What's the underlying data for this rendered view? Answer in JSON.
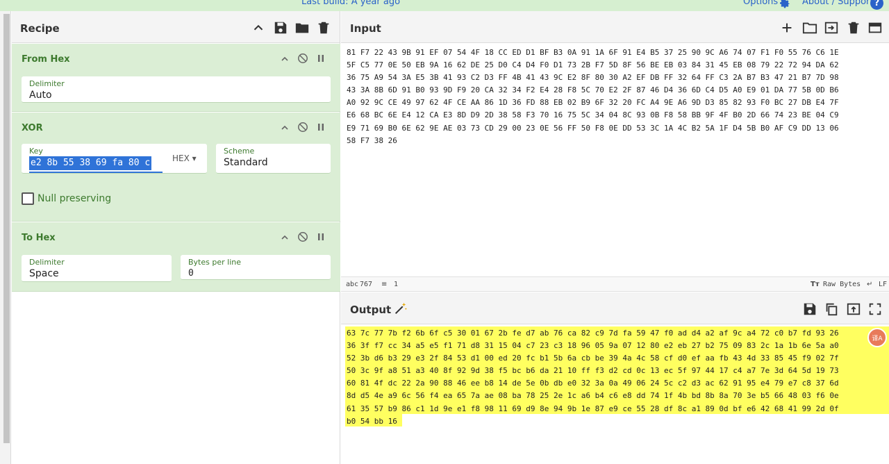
{
  "banner": {
    "last_build": "Last build: A year ago",
    "options": "Options",
    "about": "About / Support",
    "help_glyph": "?"
  },
  "recipe": {
    "title": "Recipe",
    "icons": [
      "chevron-up-icon",
      "save-icon",
      "folder-icon",
      "trash-icon"
    ],
    "operations": [
      {
        "title": "From Hex",
        "fields": [
          {
            "label": "Delimiter",
            "value": "Auto"
          }
        ]
      },
      {
        "title": "XOR",
        "key": {
          "label": "Key",
          "value": "e2 8b 55 38 69 fa 80 c",
          "format": "HEX"
        },
        "scheme": {
          "label": "Scheme",
          "value": "Standard"
        },
        "null_preserving": {
          "label": "Null preserving",
          "checked": false
        }
      },
      {
        "title": "To Hex",
        "fields": [
          {
            "label": "Delimiter",
            "value": "Space"
          },
          {
            "label": "Bytes per line",
            "value": "0"
          }
        ]
      }
    ]
  },
  "input": {
    "title": "Input",
    "text": "81 F7 22 43 9B 91 EF 07 54 4F 18 CC ED D1 BF B3 0A 91 1A 6F 91 E4 B5 37 25 90 9C A6 74 07 F1 F0 55 76 C6 1E\n5F C5 77 0E 50 EB 9A 16 62 DE 25 D0 C4 D4 F0 D1 73 2B F7 5D 8F 56 BE EB 03 84 31 45 EB 08 79 22 72 94 DA 62\n36 75 A9 54 3A E5 3B 41 93 C2 D3 FF 4B 41 43 9C E2 8F 80 30 A2 EF DB FF 32 64 FF C3 2A B7 B3 47 21 B7 7D 98\n43 3A 8B 6D 91 B0 93 9D F9 20 CA 32 34 F2 E4 28 F8 5C 70 E2 2F 87 46 D4 36 6D C4 D5 A0 E9 01 DA 77 5B 0D B6\nA0 92 9C CE 49 97 62 4F CE AA 86 1D 36 FD 88 EB 02 B9 6F 32 20 FC A4 9E A6 9D D3 85 82 93 F0 BC 27 DB E4 7F\nE6 68 BC 6E E4 12 CA E3 8D D9 2D 38 58 F3 70 16 75 5C 34 04 8C 93 0B F8 58 BB 9F 4F B0 2D 66 74 23 BE 04 C9\nE9 71 69 B0 6E 62 9E AE 03 73 CD 29 00 23 0E 56 FF 50 F8 0E DD 53 3C 1A 4C B2 5A 1F D4 5B B0 AF C9 DD 13 06\n58 F7 38 26",
    "status": {
      "chars": "767",
      "lines": "1",
      "encoding": "Raw Bytes",
      "eol": "LF"
    }
  },
  "output": {
    "title": "Output",
    "text": "63 7c 77 7b f2 6b 6f c5 30 01 67 2b fe d7 ab 76 ca 82 c9 7d fa 59 47 f0 ad d4 a2 af 9c a4 72 c0 b7 fd 93 26\n36 3f f7 cc 34 a5 e5 f1 71 d8 31 15 04 c7 23 c3 18 96 05 9a 07 12 80 e2 eb 27 b2 75 09 83 2c 1a 1b 6e 5a a0\n52 3b d6 b3 29 e3 2f 84 53 d1 00 ed 20 fc b1 5b 6a cb be 39 4a 4c 58 cf d0 ef aa fb 43 4d 33 85 45 f9 02 7f\n50 3c 9f a8 51 a3 40 8f 92 9d 38 f5 bc b6 da 21 10 ff f3 d2 cd 0c 13 ec 5f 97 44 17 c4 a7 7e 3d 64 5d 19 73\n60 81 4f dc 22 2a 90 88 46 ee b8 14 de 5e 0b db e0 32 3a 0a 49 06 24 5c c2 d3 ac 62 91 95 e4 79 e7 c8 37 6d\n8d d5 4e a9 6c 56 f4 ea 65 7a ae 08 ba 78 25 2e 1c a6 b4 c6 e8 dd 74 1f 4b bd 8b 8a 70 3e b5 66 48 03 f6 0e\n61 35 57 b9 86 c1 1d 9e e1 f8 98 11 69 d9 8e 94 9b 1e 87 e9 ce 55 28 df 8c a1 89 0d bf e6 42 68 41 99 2d 0f\nb0 54 bb 16",
    "badge": "译A"
  },
  "colors": {
    "banner_bg": "#d6efd0",
    "link": "#2a62c9",
    "op_bg": "#dbeed5",
    "op_title": "#3d7a2e",
    "selection": "#2f73d8",
    "highlight": "#ffff60"
  }
}
